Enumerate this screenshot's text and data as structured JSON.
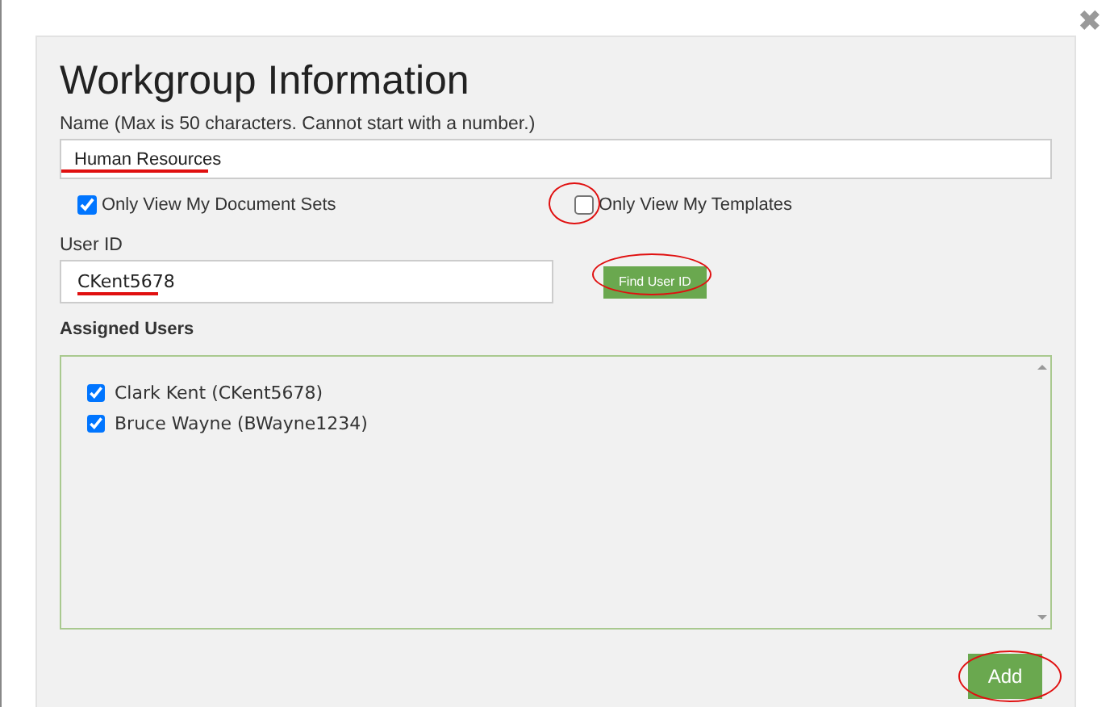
{
  "close": "✖",
  "title": "Workgroup Information",
  "name_field": {
    "label": "Name (Max is 50 characters. Cannot start with a number.)",
    "value": "Human Resources"
  },
  "options": [
    {
      "label": "Only View My Document Sets",
      "checked": true
    },
    {
      "label": "Only View My Templates",
      "checked": false
    }
  ],
  "user_id_field": {
    "label": "User ID",
    "value": "CKent5678"
  },
  "find_button": "Find User ID",
  "assigned_users": {
    "heading": "Assigned Users",
    "items": [
      {
        "label": "Clark Kent (CKent5678)",
        "checked": true
      },
      {
        "label": "Bruce Wayne (BWayne1234)",
        "checked": true
      }
    ]
  },
  "add_button": "Add"
}
